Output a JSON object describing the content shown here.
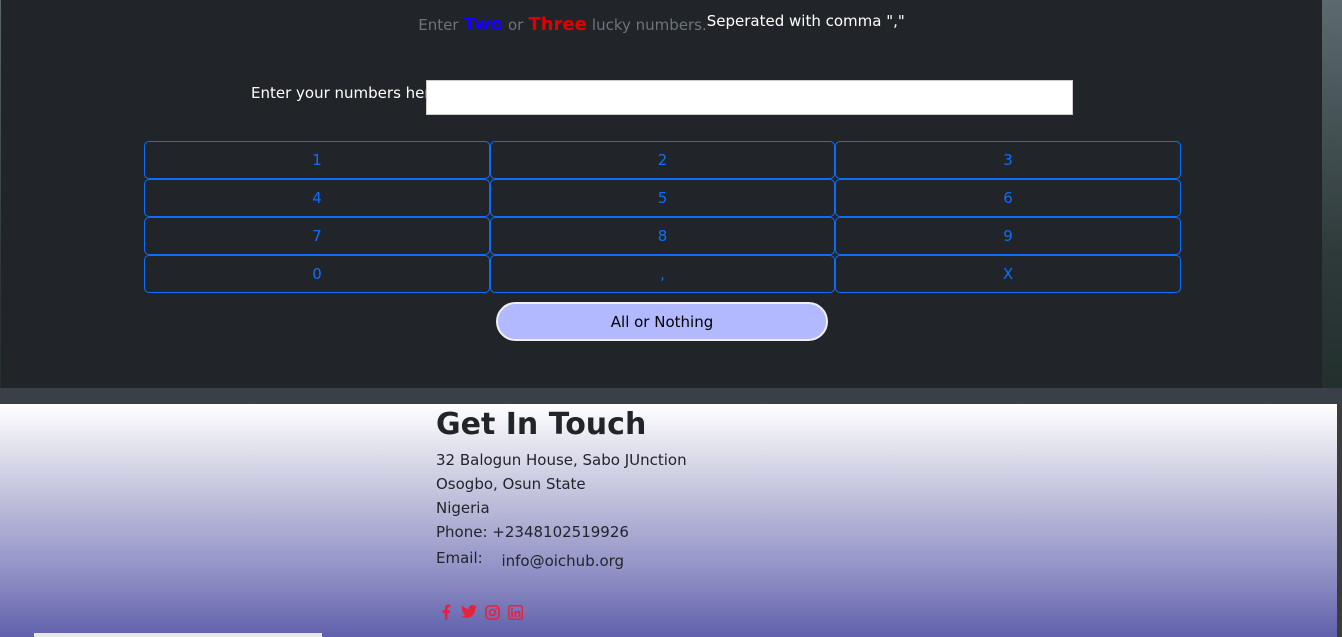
{
  "instruction": {
    "enter": "Enter",
    "two": "Two",
    "or": "or",
    "three": "Three",
    "lucky": "lucky numbers.",
    "separated": "Seperated with comma \",\""
  },
  "entry": {
    "label": "Enter your numbers here",
    "value": "",
    "placeholder": ""
  },
  "keypad": {
    "keys": [
      "1",
      "2",
      "3",
      "4",
      "5",
      "6",
      "7",
      "8",
      "9",
      "0",
      ",",
      "X"
    ]
  },
  "submit": {
    "label": "All or Nothing"
  },
  "footer": {
    "title": "Get In Touch",
    "address_line1": "32 Balogun House, Sabo JUnction",
    "address_line2": "Osogbo, Osun State",
    "country": "Nigeria",
    "phone": "Phone: +2348102519926",
    "email_label": "Email:",
    "email_value": "info@oichub.org",
    "socials": [
      "facebook-icon",
      "twitter-icon",
      "instagram-icon",
      "linkedin-icon"
    ]
  },
  "colors": {
    "two": "#1400ff",
    "three": "#e00000",
    "keypad_border": "#0d6efd",
    "submit_bg": "#b3b9ff",
    "social_icons": "#e8213a"
  }
}
